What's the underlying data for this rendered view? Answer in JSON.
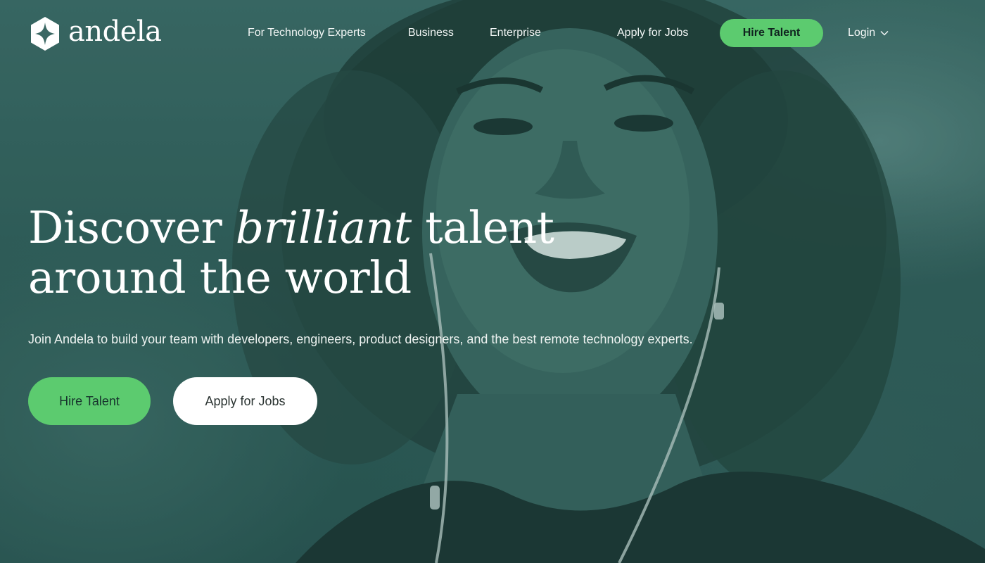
{
  "brand": {
    "name": "andela",
    "accent_color": "#5ccb6f",
    "hero_tint_color": "#2f5c58"
  },
  "nav": {
    "links": [
      {
        "label": "For Technology Experts"
      },
      {
        "label": "Business"
      },
      {
        "label": "Enterprise"
      },
      {
        "label": "Apply for Jobs"
      }
    ],
    "hire_button_label": "Hire Talent",
    "login_label": "Login",
    "login_icon": "chevron-down-icon"
  },
  "hero": {
    "headline_part1": "Discover ",
    "headline_emphasis": "brilliant",
    "headline_part2": " talent",
    "headline_line2": "around the world",
    "subtext": "Join Andela to build your team with developers, engineers, product designers, and the best remote technology experts.",
    "primary_cta": "Hire Talent",
    "secondary_cta": "Apply for Jobs"
  }
}
